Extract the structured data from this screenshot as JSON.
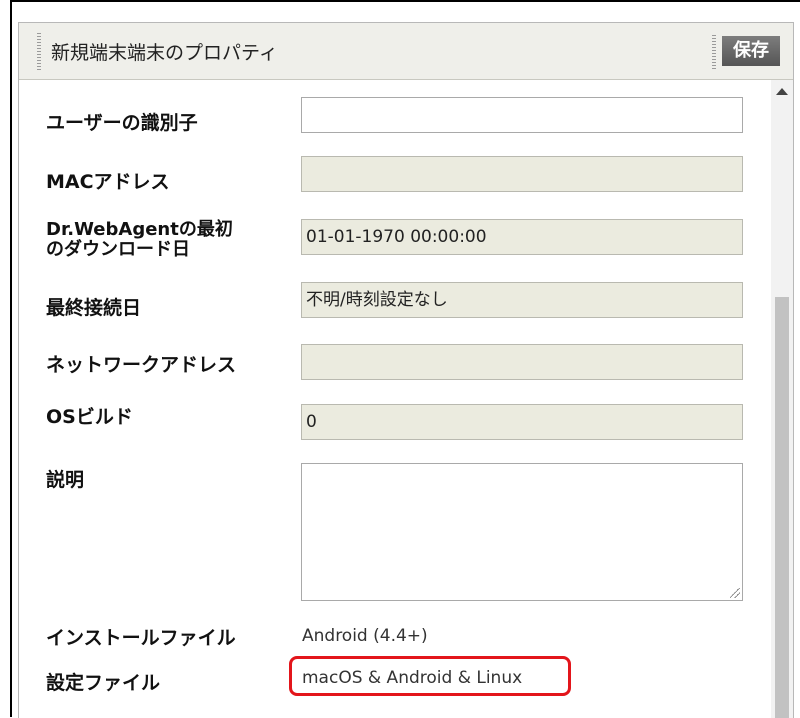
{
  "header": {
    "title": "新規端末端末のプロパティ",
    "save_label": "保存"
  },
  "fields": {
    "user_id": {
      "label": "ユーザーの識別子",
      "value": ""
    },
    "mac": {
      "label": "MACアドレス",
      "value": ""
    },
    "first_download": {
      "label_line1": "Dr.WebAgentの最初",
      "label_line2": "のダウンロード日",
      "value": "01-01-1970 00:00:00"
    },
    "last_connect": {
      "label": "最終接続日",
      "value": "不明/時刻設定なし"
    },
    "network": {
      "label": "ネットワークアドレス",
      "value": ""
    },
    "os_build": {
      "label": "OSビルド",
      "value": "0"
    },
    "description": {
      "label": "説明",
      "value": ""
    },
    "install_file": {
      "label": "インストールファイル",
      "value": "Android (4.4+)"
    },
    "config_file": {
      "label": "設定ファイル",
      "value": "macOS & Android & Linux"
    }
  },
  "colors": {
    "highlight": "#e3151b",
    "readonly_field": "#ebebdf",
    "header_bg": "#efefea"
  }
}
